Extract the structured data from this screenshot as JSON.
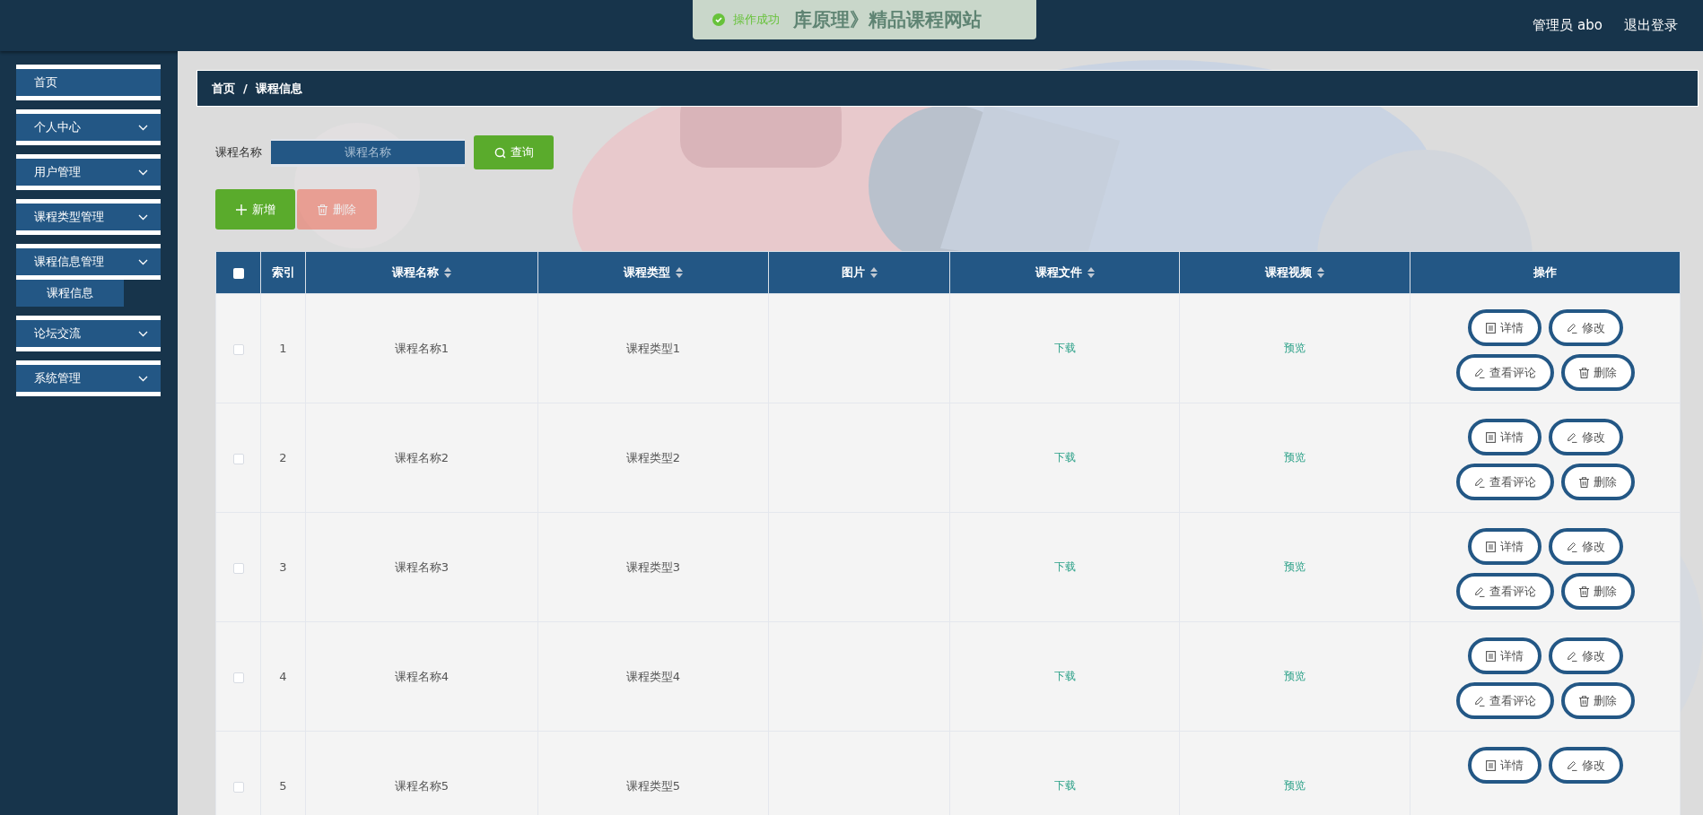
{
  "header": {
    "site_title": "库原理》精品课程网站",
    "user": "管理员 abo",
    "logout": "退出登录"
  },
  "toast": {
    "message": "操作成功"
  },
  "sidebar": {
    "items": [
      {
        "label": "首页",
        "kind": "link"
      },
      {
        "label": "个人中心",
        "kind": "menu"
      },
      {
        "label": "用户管理",
        "kind": "menu"
      },
      {
        "label": "课程类型管理",
        "kind": "menu"
      },
      {
        "label": "课程信息管理",
        "kind": "menu",
        "children": [
          {
            "label": "课程信息",
            "selected": true
          }
        ]
      },
      {
        "label": "论坛交流",
        "kind": "menu"
      },
      {
        "label": "系统管理",
        "kind": "menu"
      }
    ]
  },
  "breadcrumb": {
    "items": [
      "首页",
      "课程信息"
    ],
    "separator": "/"
  },
  "search": {
    "label": "课程名称",
    "placeholder": "课程名称",
    "button": "查询"
  },
  "actions": [
    {
      "label": "新增",
      "kind": "add",
      "disabled": false
    },
    {
      "label": "删除",
      "kind": "delete",
      "disabled": true
    }
  ],
  "table": {
    "columns": [
      {
        "kind": "checkbox",
        "checked": false
      },
      {
        "kind": "text",
        "label": "索引",
        "sortable": false
      },
      {
        "kind": "text",
        "label": "课程名称",
        "sortable": true
      },
      {
        "kind": "text",
        "label": "课程类型",
        "sortable": true
      },
      {
        "kind": "text",
        "label": "图片",
        "sortable": true
      },
      {
        "kind": "text",
        "label": "课程文件",
        "sortable": true
      },
      {
        "kind": "text",
        "label": "课程视频",
        "sortable": true
      },
      {
        "kind": "text",
        "label": "操作",
        "sortable": false
      }
    ],
    "rows": [
      {
        "checked": false,
        "index": "1",
        "name": "课程名称1",
        "type": "课程类型1",
        "file": "下载",
        "video": "预览",
        "actions": [
          {
            "label": "详情",
            "kind": "detail"
          },
          {
            "label": "修改",
            "kind": "edit"
          },
          {
            "label": "查看评论",
            "kind": "comment"
          },
          {
            "label": "删除",
            "kind": "delete"
          }
        ]
      },
      {
        "checked": false,
        "index": "2",
        "name": "课程名称2",
        "type": "课程类型2",
        "file": "下载",
        "video": "预览",
        "actions": [
          {
            "label": "详情",
            "kind": "detail"
          },
          {
            "label": "修改",
            "kind": "edit"
          },
          {
            "label": "查看评论",
            "kind": "comment"
          },
          {
            "label": "删除",
            "kind": "delete"
          }
        ]
      },
      {
        "checked": false,
        "index": "3",
        "name": "课程名称3",
        "type": "课程类型3",
        "file": "下载",
        "video": "预览",
        "actions": [
          {
            "label": "详情",
            "kind": "detail"
          },
          {
            "label": "修改",
            "kind": "edit"
          },
          {
            "label": "查看评论",
            "kind": "comment"
          },
          {
            "label": "删除",
            "kind": "delete"
          }
        ]
      },
      {
        "checked": false,
        "index": "4",
        "name": "课程名称4",
        "type": "课程类型4",
        "file": "下载",
        "video": "预览",
        "actions": [
          {
            "label": "详情",
            "kind": "detail"
          },
          {
            "label": "修改",
            "kind": "edit"
          },
          {
            "label": "查看评论",
            "kind": "comment"
          },
          {
            "label": "删除",
            "kind": "delete"
          }
        ]
      },
      {
        "checked": false,
        "index": "5",
        "name": "课程名称5",
        "type": "课程类型5",
        "file": "下载",
        "video": "预览",
        "actions": [
          {
            "label": "详情",
            "kind": "detail"
          },
          {
            "label": "修改",
            "kind": "edit"
          }
        ]
      }
    ]
  }
}
